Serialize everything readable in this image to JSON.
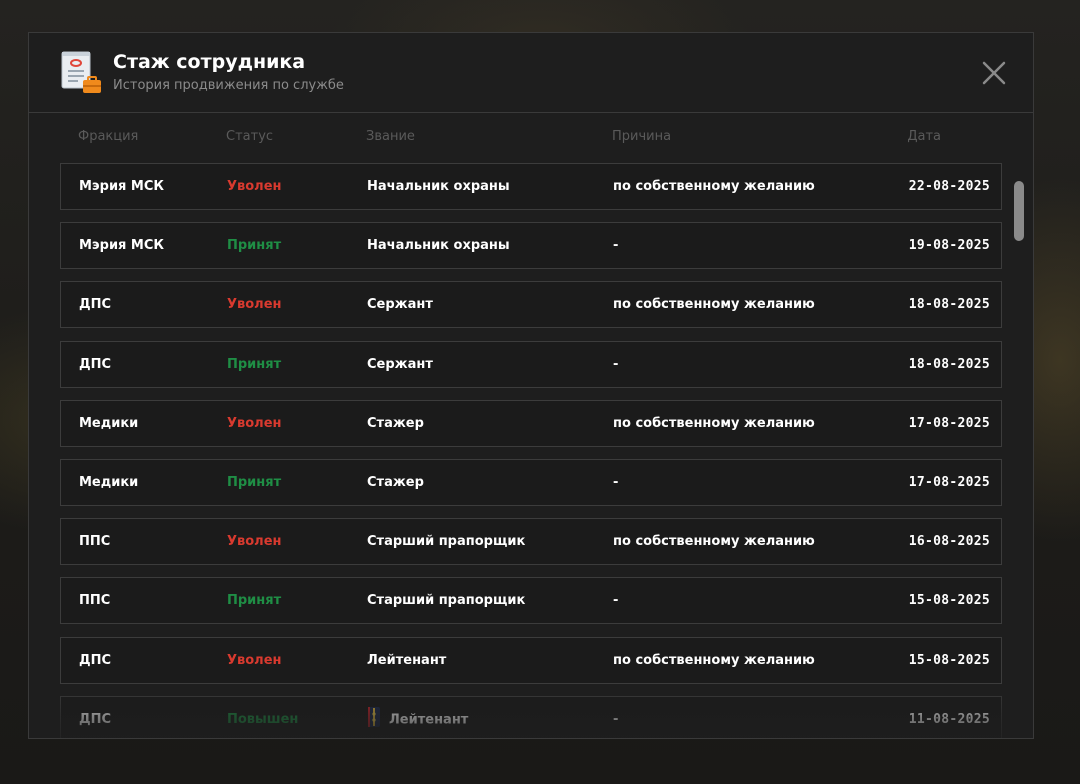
{
  "modal": {
    "title": "Стаж сотрудника",
    "subtitle": "История продвижения по службе",
    "icon": "document-icon",
    "close_icon": "close-icon"
  },
  "columns": {
    "faction": "Фракция",
    "status": "Статус",
    "rank": "Звание",
    "reason": "Причина",
    "date": "Дата"
  },
  "rows": [
    {
      "faction": "Мэрия МСК",
      "status": "Уволен",
      "status_type": "fired",
      "rank": "Начальник охраны",
      "reason": "по собственному желанию",
      "date": "22-08-2025"
    },
    {
      "faction": "Мэрия МСК",
      "status": "Принят",
      "status_type": "hired",
      "rank": "Начальник охраны",
      "reason": "-",
      "date": "19-08-2025"
    },
    {
      "faction": "ДПС",
      "status": "Уволен",
      "status_type": "fired",
      "rank": "Сержант",
      "reason": "по собственному желанию",
      "date": "18-08-2025"
    },
    {
      "faction": "ДПС",
      "status": "Принят",
      "status_type": "hired",
      "rank": "Сержант",
      "reason": "-",
      "date": "18-08-2025"
    },
    {
      "faction": "Медики",
      "status": "Уволен",
      "status_type": "fired",
      "rank": "Стажер",
      "reason": "по собственному желанию",
      "date": "17-08-2025"
    },
    {
      "faction": "Медики",
      "status": "Принят",
      "status_type": "hired",
      "rank": "Стажер",
      "reason": "-",
      "date": "17-08-2025"
    },
    {
      "faction": "ППС",
      "status": "Уволен",
      "status_type": "fired",
      "rank": "Старший прапорщик",
      "reason": "по собственному желанию",
      "date": "16-08-2025"
    },
    {
      "faction": "ППС",
      "status": "Принят",
      "status_type": "hired",
      "rank": "Старший прапорщик",
      "reason": "-",
      "date": "15-08-2025"
    },
    {
      "faction": "ДПС",
      "status": "Уволен",
      "status_type": "fired",
      "rank": "Лейтенант",
      "reason": "по собственному желанию",
      "date": "15-08-2025"
    },
    {
      "faction": "ДПС",
      "status": "Повышен",
      "status_type": "promo",
      "rank": "Лейтенант",
      "rank_icon": "rank-insignia-icon",
      "reason": "-",
      "date": "11-08-2025"
    }
  ],
  "colors": {
    "fired": "#d93a2f",
    "hired": "#1f8e45",
    "panel": "#1e1e1e",
    "border": "#3a3a3a"
  }
}
